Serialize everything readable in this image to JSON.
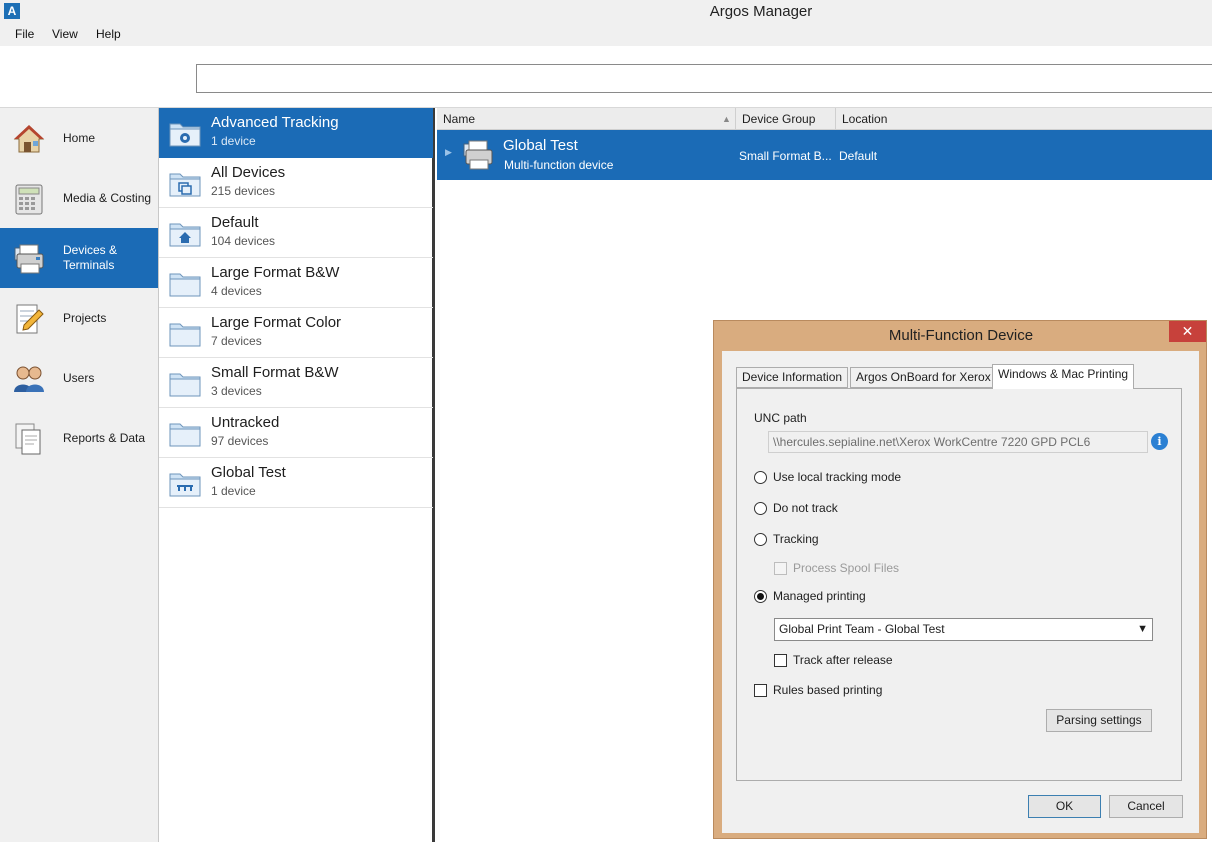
{
  "app": {
    "logo_letter": "A",
    "title": "Argos Manager"
  },
  "menu": {
    "items": [
      "File",
      "View",
      "Help"
    ]
  },
  "search": {
    "value": ""
  },
  "nav": {
    "items": [
      {
        "label": "Home",
        "icon": "home-icon"
      },
      {
        "label": "Media & Costing",
        "icon": "calculator-icon"
      },
      {
        "label": "Devices & Terminals",
        "icon": "printer-icon",
        "active": true
      },
      {
        "label": "Projects",
        "icon": "pencil-document-icon"
      },
      {
        "label": "Users",
        "icon": "users-icon"
      },
      {
        "label": "Reports & Data",
        "icon": "report-icon"
      }
    ]
  },
  "groups": {
    "items": [
      {
        "name": "Advanced Tracking",
        "count": "1 device",
        "icon": "gear-folder-icon",
        "active": true
      },
      {
        "name": "All Devices",
        "count": "215 devices",
        "icon": "stack-folder-icon"
      },
      {
        "name": "Default",
        "count": "104 devices",
        "icon": "home-folder-icon"
      },
      {
        "name": "Large Format B&W",
        "count": "4 devices",
        "icon": "folder-icon"
      },
      {
        "name": "Large Format Color",
        "count": "7 devices",
        "icon": "folder-icon"
      },
      {
        "name": "Small Format B&W",
        "count": "3 devices",
        "icon": "folder-icon"
      },
      {
        "name": "Untracked",
        "count": "97 devices",
        "icon": "folder-icon"
      },
      {
        "name": "Global Test",
        "count": "1 device",
        "icon": "network-folder-icon"
      }
    ]
  },
  "table": {
    "columns": [
      "Name",
      "Device Group",
      "Location"
    ],
    "rows": [
      {
        "name": "Global Test",
        "type": "Multi-function device",
        "group": "Small Format B...",
        "location": "Default"
      }
    ]
  },
  "dialog": {
    "title": "Multi-Function Device",
    "close_glyph": "✕",
    "tabs": [
      "Device Information",
      "Argos OnBoard for Xerox",
      "Windows & Mac Printing"
    ],
    "active_tab": "Windows & Mac Printing",
    "unc_label": "UNC path",
    "unc_value": "\\\\hercules.sepialine.net\\Xerox WorkCentre 7220 GPD PCL6",
    "options": {
      "local": "Use local tracking mode",
      "notrack": "Do not track",
      "tracking": "Tracking",
      "spool": "Process Spool Files",
      "managed": "Managed printing",
      "track_after": "Track after release",
      "rules": "Rules based printing"
    },
    "selected_option": "Managed printing",
    "team_select": "Global Print Team - Global Test",
    "parsing_button": "Parsing settings",
    "ok_button": "OK",
    "cancel_button": "Cancel"
  }
}
